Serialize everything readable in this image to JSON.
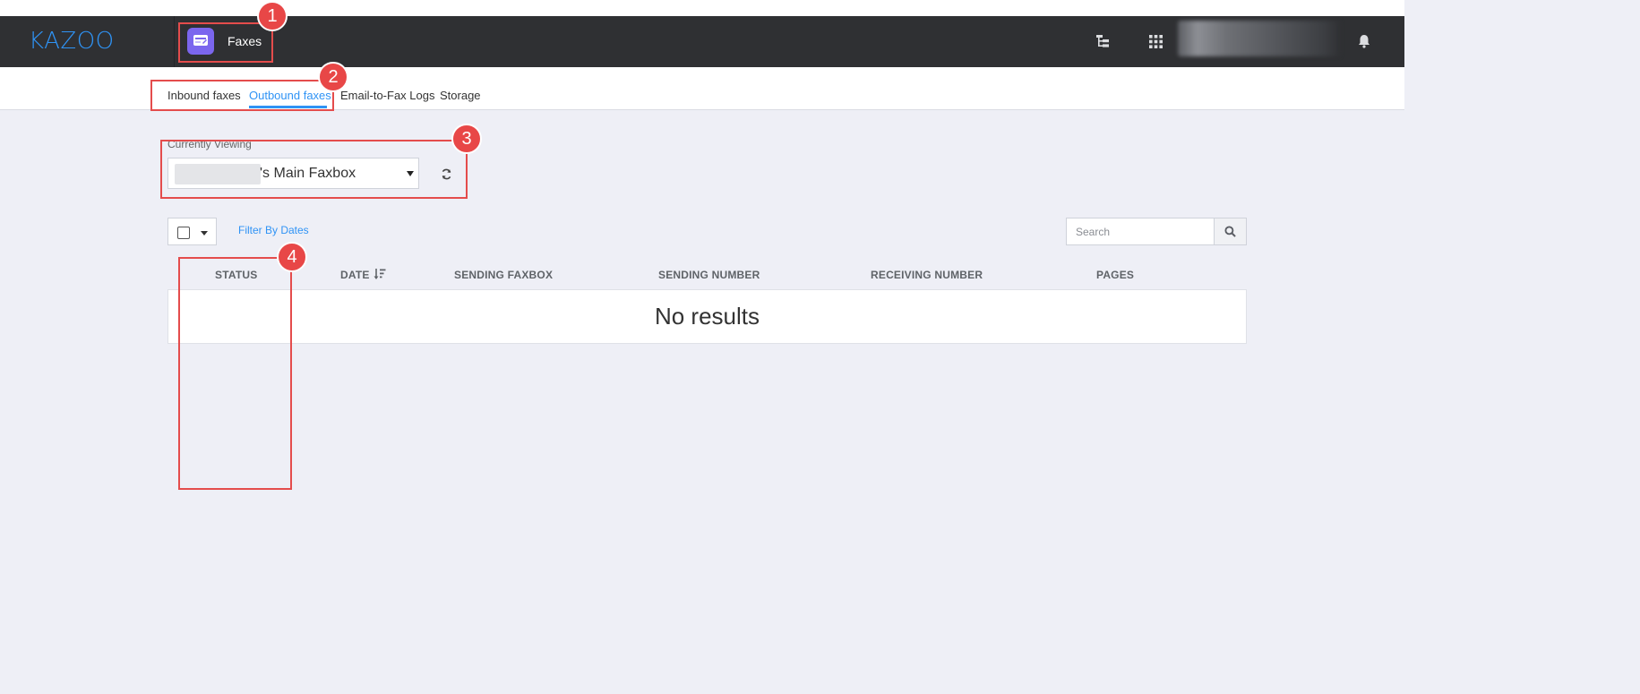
{
  "header": {
    "logo": "KAZOO",
    "app_name": "Faxes",
    "icons": [
      "account-tree-icon",
      "app-grid-icon",
      "bell-icon"
    ]
  },
  "tabs": [
    {
      "label": "Inbound faxes",
      "active": false
    },
    {
      "label": "Outbound faxes",
      "active": true
    },
    {
      "label": "Email-to-Fax Logs",
      "active": false
    },
    {
      "label": "Storage",
      "active": false
    }
  ],
  "faxbox": {
    "label": "Currently Viewing",
    "selected_suffix": "'s Main Faxbox"
  },
  "toolbar": {
    "filter_label": "Filter By Dates",
    "search_placeholder": "Search"
  },
  "table": {
    "columns": [
      "STATUS",
      "DATE",
      "SENDING FAXBOX",
      "SENDING NUMBER",
      "RECEIVING NUMBER",
      "PAGES"
    ],
    "sorted_column": "DATE",
    "empty_message": "No results"
  },
  "annotations": [
    "1",
    "2",
    "3",
    "4"
  ],
  "colors": {
    "accent": "#2f93f5",
    "topbar": "#2f3033",
    "app_tile": "#7b66ee",
    "annotation": "#e84747",
    "background": "#eeeff6"
  }
}
